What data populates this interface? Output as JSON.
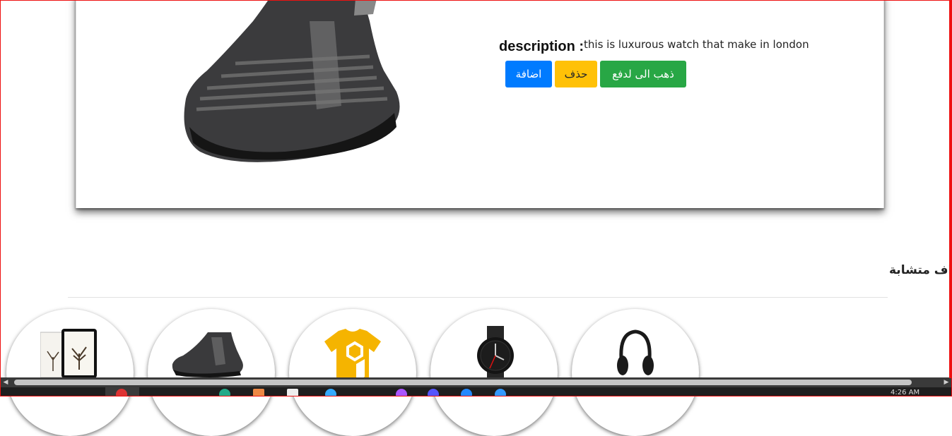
{
  "product": {
    "description_label": "description :",
    "description_text": "this is luxurous watch that make in london",
    "image": "shoe-image"
  },
  "actions": {
    "add_label": "اضافة",
    "delete_label": "حذف",
    "pay_label": "ذهب الى لدفع"
  },
  "similar": {
    "title": "اف متشابة",
    "items": [
      {
        "name": "book-thumbnail"
      },
      {
        "name": "shoe-thumbnail"
      },
      {
        "name": "tshirt-thumbnail"
      },
      {
        "name": "watch-thumbnail"
      },
      {
        "name": "headphones-thumbnail"
      }
    ]
  },
  "taskbar": {
    "time": "4:26 AM"
  },
  "colors": {
    "primary": "#007bff",
    "warning": "#ffc107",
    "success": "#28a745"
  }
}
